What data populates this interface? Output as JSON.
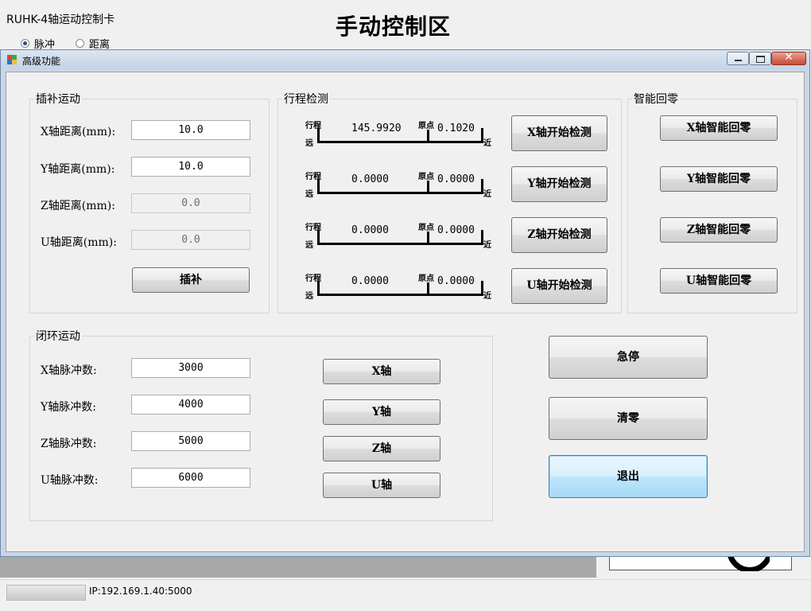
{
  "background": {
    "title": "RUHK-4轴运动控制卡",
    "heading": "手动控制区",
    "radios": [
      {
        "label": "脉冲",
        "selected": true
      },
      {
        "label": "距离",
        "selected": false
      }
    ],
    "status_ip": "IP:192.169.1.40:5000"
  },
  "dialog": {
    "title": "高级功能",
    "interp": {
      "group_label": "插补运动",
      "rows": [
        {
          "label": "X轴距离(mm):",
          "value": "10.0",
          "enabled": true
        },
        {
          "label": "Y轴距离(mm):",
          "value": "10.0",
          "enabled": true
        },
        {
          "label": "Z轴距离(mm):",
          "value": "0.0",
          "enabled": false
        },
        {
          "label": "U轴距离(mm):",
          "value": "0.0",
          "enabled": false
        }
      ],
      "button": "插补"
    },
    "travel": {
      "group_label": "行程检测",
      "stroke_label": "行程",
      "origin_label": "原点",
      "far_label": "远",
      "near_label": "近",
      "rows": [
        {
          "stroke": "145.9920",
          "origin": "0.1020",
          "button": "X轴开始检测"
        },
        {
          "stroke": "0.0000",
          "origin": "0.0000",
          "button": "Y轴开始检测"
        },
        {
          "stroke": "0.0000",
          "origin": "0.0000",
          "button": "Z轴开始检测"
        },
        {
          "stroke": "0.0000",
          "origin": "0.0000",
          "button": "U轴开始检测"
        }
      ]
    },
    "homing": {
      "group_label": "智能回零",
      "buttons": [
        "X轴智能回零",
        "Y轴智能回零",
        "Z轴智能回零",
        "U轴智能回零"
      ]
    },
    "closed_loop": {
      "group_label": "闭环运动",
      "rows": [
        {
          "label": "X轴脉冲数:",
          "value": "3000",
          "button": "X轴"
        },
        {
          "label": "Y轴脉冲数:",
          "value": "4000",
          "button": "Y轴"
        },
        {
          "label": "Z轴脉冲数:",
          "value": "5000",
          "button": "Z轴"
        },
        {
          "label": "U轴脉冲数:",
          "value": "6000",
          "button": "U轴"
        }
      ]
    },
    "actions": {
      "estop": "急停",
      "clear": "清零",
      "exit": "退出"
    },
    "window_buttons": {
      "close": "✕"
    }
  }
}
